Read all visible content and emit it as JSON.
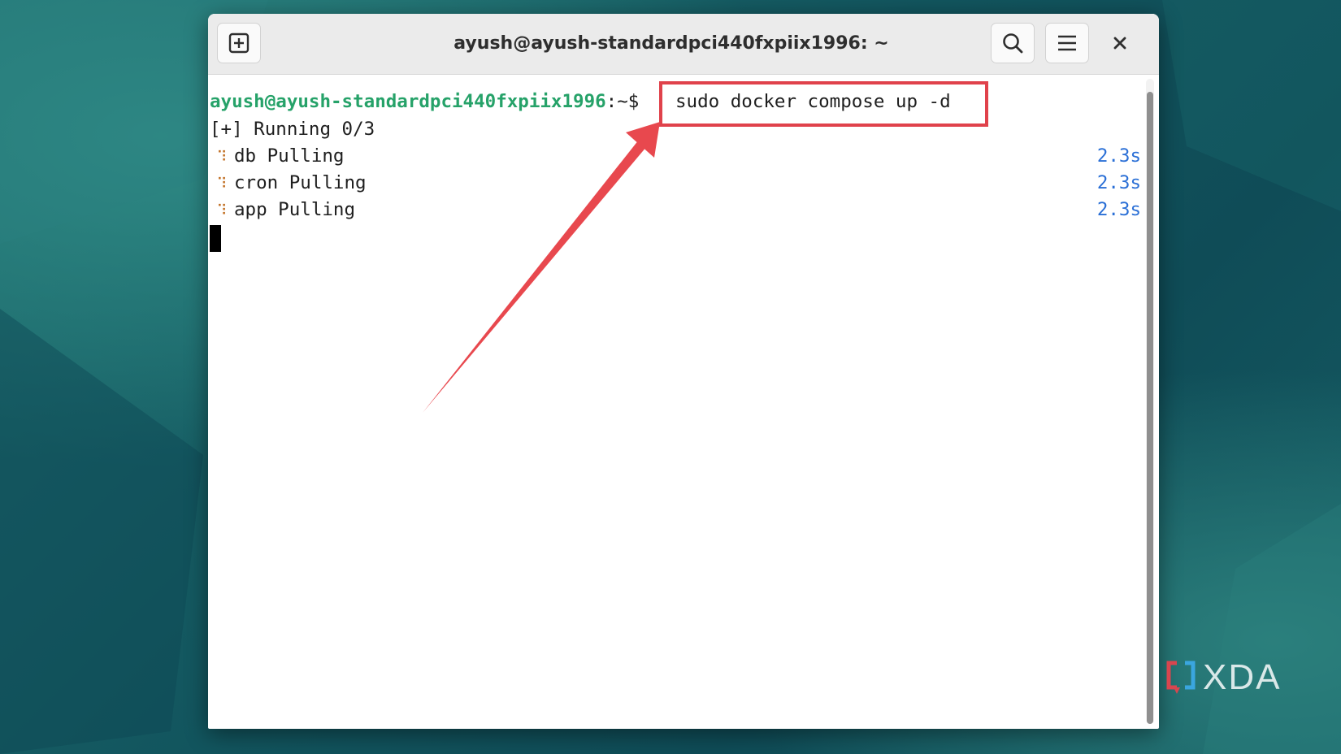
{
  "window": {
    "title": "ayush@ayush-standardpci440fxpiix1996: ~",
    "buttons": {
      "new_tab_icon": "new-tab-icon",
      "search_icon": "search-icon",
      "menu_icon": "hamburger-menu-icon",
      "close_icon": "close-icon"
    }
  },
  "terminal": {
    "prompt_user": "ayush@ayush-standardpci440fxpiix1996",
    "prompt_suffix": ":~$",
    "command": "sudo docker compose up -d",
    "status_line": "[+] Running 0/3",
    "spinner_glyph": "⠹",
    "pull_rows": [
      {
        "label": "db Pulling",
        "time": "2.3s"
      },
      {
        "label": "cron Pulling",
        "time": "2.3s"
      },
      {
        "label": "app Pulling",
        "time": "2.3s"
      }
    ]
  },
  "annotation": {
    "highlight_color": "#e0424b",
    "arrow_color": "#e8484e"
  },
  "watermark": {
    "text": "XDA"
  }
}
